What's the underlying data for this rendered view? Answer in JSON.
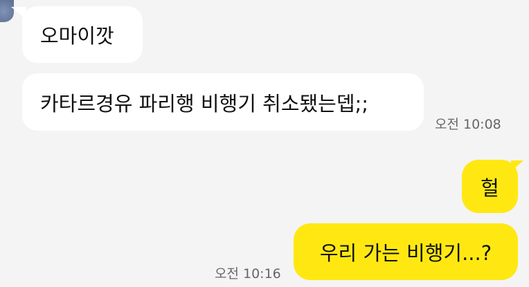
{
  "messages": [
    {
      "sender": "other",
      "text": "오마이깟"
    },
    {
      "sender": "other",
      "text": "카타르경유 파리행 비행기 취소됐는뎁;;",
      "time": "오전 10:08"
    },
    {
      "sender": "me",
      "text": "헐"
    },
    {
      "sender": "me",
      "text": "우리 가는 비행기...?",
      "time": "오전 10:16"
    }
  ],
  "colors": {
    "background": "#f4f4f5",
    "incoming_bubble": "#ffffff",
    "outgoing_bubble": "#ffe812",
    "timestamp": "#666666"
  },
  "icons": {
    "avatar": "profile-avatar"
  }
}
